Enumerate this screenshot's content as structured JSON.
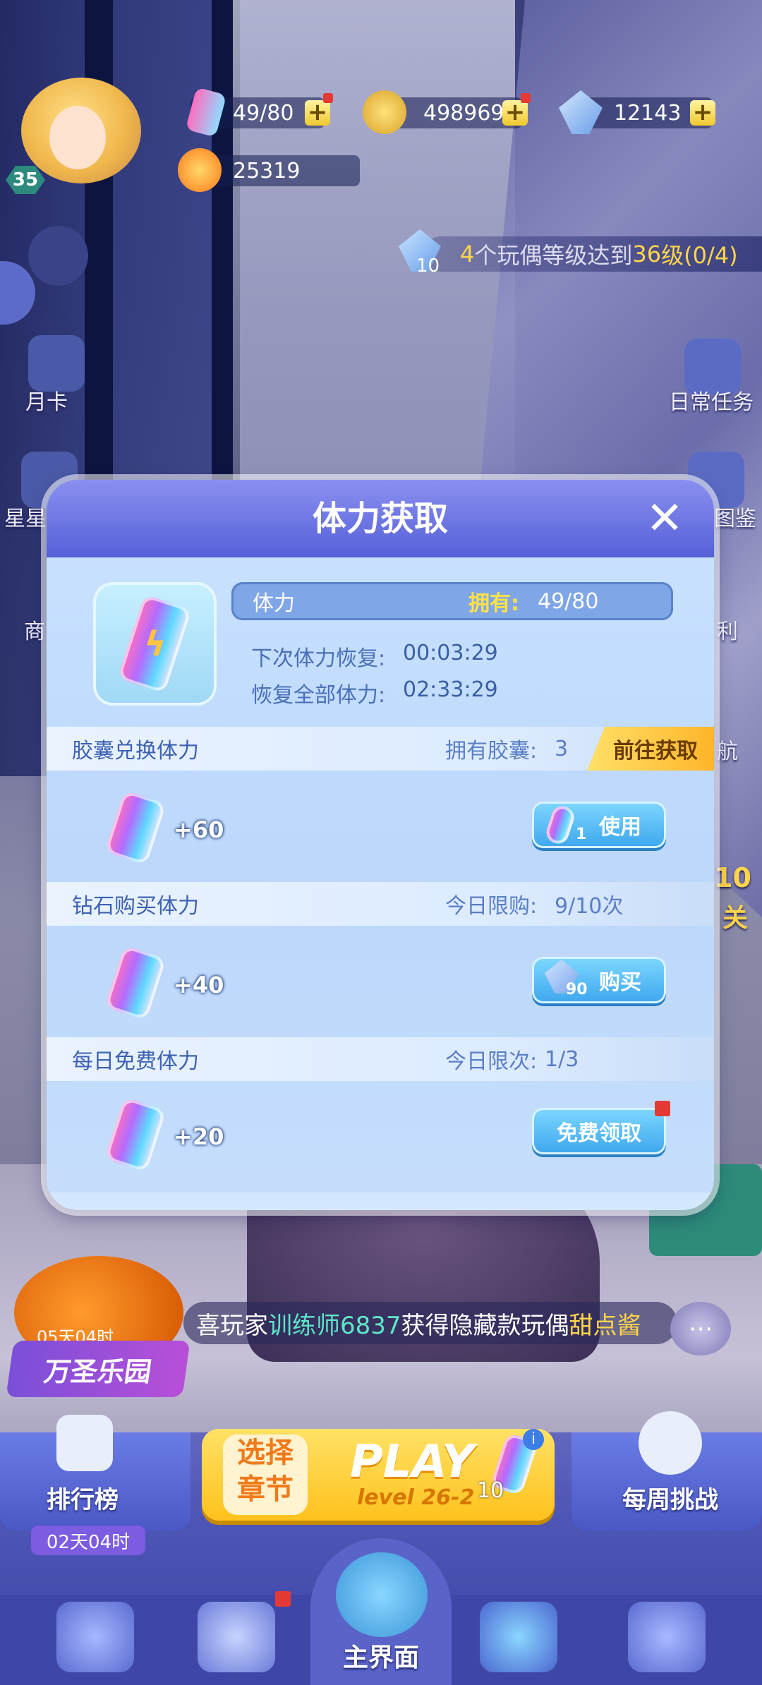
{
  "hud": {
    "level": "35",
    "stamina": "49/80",
    "coins": "498969",
    "gems": "12143",
    "trophy": "25319"
  },
  "mission": {
    "gem_count": "10",
    "text_prefix": "4",
    "text_mid": "个玩偶等级达到",
    "text_level": "36",
    "text_suffix": "级(0/4)"
  },
  "sidebar_left": {
    "monthly_card": "月卡",
    "star_shop": "星星",
    "shop": "商"
  },
  "sidebar_right": {
    "daily_tasks": "日常任务",
    "collection": "图鉴",
    "welfare": "利",
    "voyage": "航",
    "level_count": "10",
    "level_suffix": "关"
  },
  "modal": {
    "title": "体力获取",
    "stat_label": "体力",
    "owned_label": "拥有:",
    "owned_value": "49/80",
    "next_recover_label": "下次体力恢复:",
    "next_recover_value": "00:03:29",
    "full_recover_label": "恢复全部体力:",
    "full_recover_value": "02:33:29",
    "sections": [
      {
        "title": "胶囊兑换体力",
        "limit_label": "拥有胶囊:",
        "limit_value": "3",
        "goto": "前往获取",
        "gain": "+60",
        "button_count": "1",
        "button": "使用"
      },
      {
        "title": "钻石购买体力",
        "limit_label": "今日限购:",
        "limit_value": "9/10次",
        "gain": "+40",
        "button_count": "90",
        "button": "购买"
      },
      {
        "title": "每日免费体力",
        "limit_label": "今日限次:",
        "limit_value": "1/3",
        "gain": "+20",
        "button": "免费领取"
      }
    ]
  },
  "notice": {
    "prefix": "喜玩家",
    "player": "训练师6837",
    "middle": "获得隐藏款玩偶",
    "item": "甜点酱"
  },
  "event": {
    "time": "05天04时",
    "name": "万圣乐园"
  },
  "bottom": {
    "ranking": "排行榜",
    "ranking_timer": "02天04时",
    "choose_chapter": "选择章节",
    "choose_line1": "选择",
    "choose_line2": "章节",
    "play": "PLAY",
    "level": "level 26-2",
    "play_cost": "10",
    "weekly": "每周挑战",
    "home": "主界面"
  },
  "colors": {
    "modal_header": "#5660d8",
    "accent_yellow": "#ffc21d",
    "button_blue": "#3da6ee"
  }
}
